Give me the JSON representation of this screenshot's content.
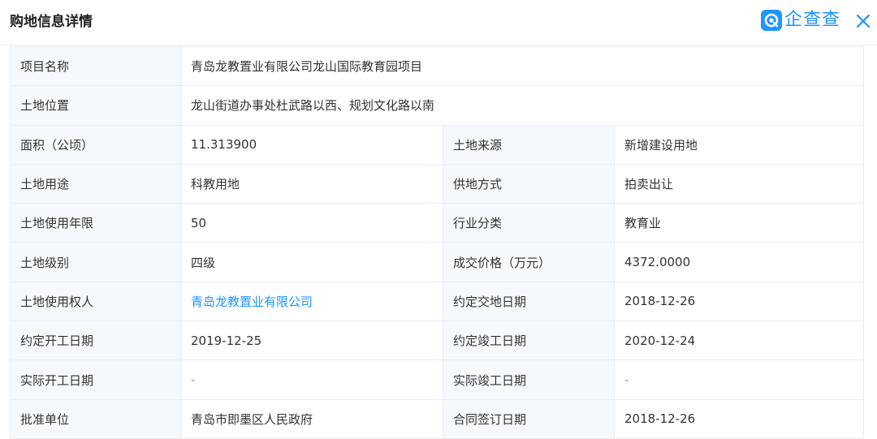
{
  "header": {
    "title": "购地信息详情",
    "brand": {
      "name": "企查查",
      "icon": "qichacha-logo-icon",
      "color": "#1f95ff"
    },
    "close_icon": "close-icon"
  },
  "colors": {
    "label_bg": "#f5f8fd",
    "link": "#1f95ff",
    "border": "#ececec"
  },
  "rows": [
    {
      "label": "项目名称",
      "value": "青岛龙教置业有限公司龙山国际教育园项目"
    },
    {
      "label": "土地位置",
      "value": "龙山街道办事处杜武路以西、规划文化路以南"
    }
  ],
  "pairs": [
    {
      "label1": "面积（公顷）",
      "value1": "11.313900",
      "label2": "土地来源",
      "value2": "新增建设用地"
    },
    {
      "label1": "土地用途",
      "value1": "科教用地",
      "label2": "供地方式",
      "value2": "拍卖出让"
    },
    {
      "label1": "土地使用年限",
      "value1": "50",
      "label2": "行业分类",
      "value2": "教育业"
    },
    {
      "label1": "土地级别",
      "value1": "四级",
      "label2": "成交价格（万元）",
      "value2": "4372.0000"
    },
    {
      "label1": "土地使用权人",
      "value1": "青岛龙教置业有限公司",
      "label2": "约定交地日期",
      "value2": "2018-12-26"
    },
    {
      "label1": "约定开工日期",
      "value1": "2019-12-25",
      "label2": "约定竣工日期",
      "value2": "2020-12-24"
    },
    {
      "label1": "实际开工日期",
      "value1": "-",
      "label2": "实际竣工日期",
      "value2": "-"
    },
    {
      "label1": "批准单位",
      "value1": "青岛市即墨区人民政府",
      "label2": "合同签订日期",
      "value2": "2018-12-26"
    }
  ]
}
